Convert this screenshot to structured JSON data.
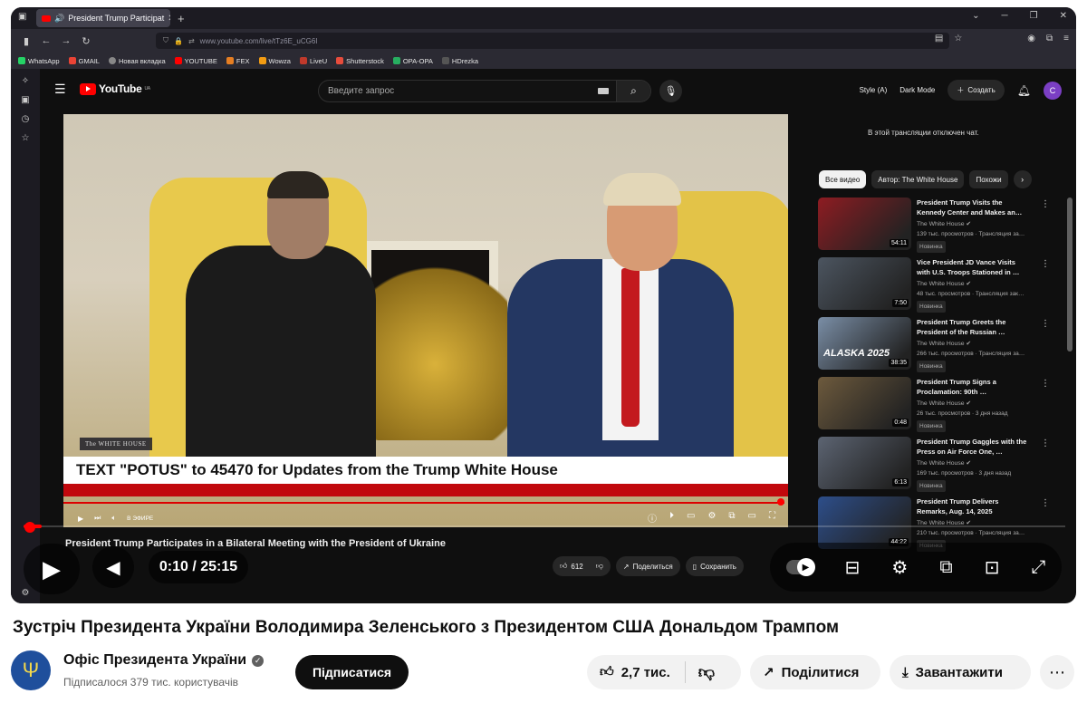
{
  "browser": {
    "tab_title": "President Trump Participat",
    "url": "www.youtube.com/live/tTz6E_uCG6I",
    "bookmarks": [
      "WhatsApp",
      "GMAIL",
      "Новая вкладка",
      "YOUTUBE",
      "FEX",
      "Wowza",
      "LiveU",
      "Shutterstock",
      "OPA-OPA",
      "HDrezka"
    ]
  },
  "header": {
    "logo": "YouTube",
    "logo_region": "UA",
    "search_placeholder": "Введите запрос",
    "style_label": "Style (A)",
    "dark_mode_label": "Dark Mode",
    "create_label": "Создать",
    "avatar_letter": "C"
  },
  "video": {
    "watermark": "The WHITE HOUSE",
    "lower_third": "TEXT \"POTUS\" to 45470 for Updates from the Trump White House",
    "live_label": "В ЭФИРЕ"
  },
  "chat_disabled": "В этой трансляции отключен чат.",
  "chips": [
    "Все видео",
    "Автор: The White House",
    "Похожи"
  ],
  "recommendations": [
    {
      "title": "President Trump Visits the Kennedy Center and Makes an…",
      "channel": "The White House",
      "meta": "139 тыс. просмотров · Трансляция за…",
      "badge": "Новинка",
      "duration": "54:11",
      "thumb": "#8e1c22",
      "overlay": ""
    },
    {
      "title": "Vice President JD Vance Visits with U.S. Troops Stationed in …",
      "channel": "The White House",
      "meta": "48 тыс. просмотров · Трансляция зак…",
      "badge": "Новинка",
      "duration": "7:50",
      "thumb": "#4c5560",
      "overlay": ""
    },
    {
      "title": "President Trump Greets the President of the Russian …",
      "channel": "The White House",
      "meta": "266 тыс. просмотров · Трансляция за…",
      "badge": "Новинка",
      "duration": "38:35",
      "thumb": "#7a8ea6",
      "overlay": "ALASKA 2025"
    },
    {
      "title": "President Trump Signs a Proclamation: 90th …",
      "channel": "The White House",
      "meta": "26 тыс. просмотров · 3 дня назад",
      "badge": "Новинка",
      "duration": "0:48",
      "thumb": "#6d5a3d",
      "overlay": ""
    },
    {
      "title": "President Trump Gaggles with the Press on Air Force One, …",
      "channel": "The White House",
      "meta": "169 тыс. просмотров · 3 дня назад",
      "badge": "Новинка",
      "duration": "6:13",
      "thumb": "#5c6472",
      "overlay": ""
    },
    {
      "title": "President Trump Delivers Remarks, Aug. 14, 2025",
      "channel": "The White House",
      "meta": "210 тыс. просмотров · Трансляция за…",
      "badge": "Новинка",
      "duration": "44:22",
      "thumb": "#2d4e8a",
      "overlay": ""
    }
  ],
  "overlay_title": "President Trump Participates in a Bilateral Meeting with the President of Ukraine",
  "player": {
    "time": "0:10 / 25:15",
    "inner_like": "612",
    "inner_share": "Поделиться",
    "inner_save": "Сохранить",
    "progress_fraction": 0.0066
  },
  "page": {
    "title": "Зустріч Президента України Володимира Зеленського з Президентом США Дональдом Трампом",
    "channel": "Офіс Президента України",
    "subscribers": "Підписалося 379 тис. користувачів",
    "subscribe_label": "Підписатися",
    "likes": "2,7 тис.",
    "share_label": "Поділитися",
    "download_label": "Завантажити"
  }
}
